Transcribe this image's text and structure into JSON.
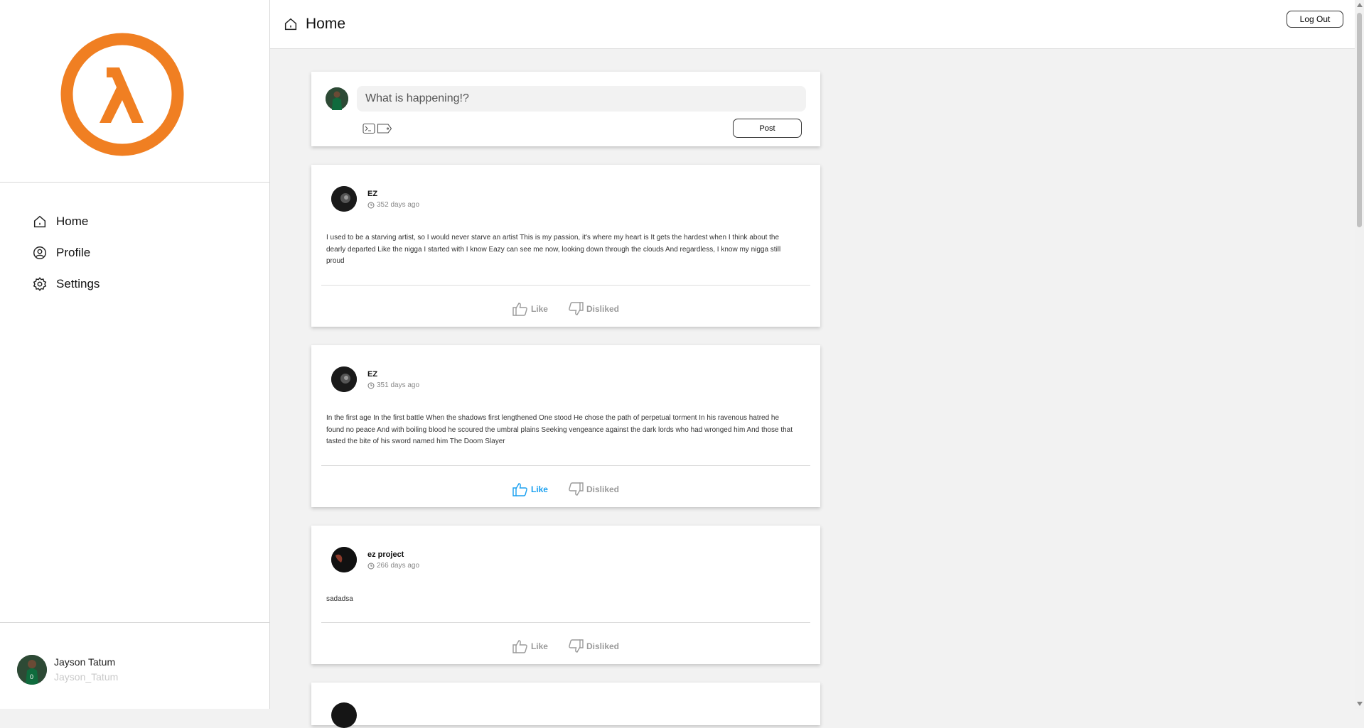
{
  "header": {
    "title": "Home",
    "logout_label": "Log Out"
  },
  "sidebar": {
    "logo": "half-life-lambda-logo",
    "nav": [
      {
        "label": "Home",
        "icon": "home-icon"
      },
      {
        "label": "Profile",
        "icon": "user-circle-icon"
      },
      {
        "label": "Settings",
        "icon": "gear-icon"
      }
    ],
    "user": {
      "name": "Jayson Tatum",
      "handle": "Jayson_Tatum"
    }
  },
  "composer": {
    "placeholder": "What is happening!?",
    "post_label": "Post"
  },
  "posts": [
    {
      "author": "EZ",
      "time": "352 days ago",
      "body": "I used to be a starving artist, so I would never starve an artist This is my passion, it's where my heart is It gets the hardest when I think about the dearly departed Like the nigga I started with I know Eazy can see me now, looking down through the clouds And regardless, I know my nigga still proud",
      "like_label": "Like",
      "dislike_label": "Disliked",
      "liked": false
    },
    {
      "author": "EZ",
      "time": "351 days ago",
      "body": "In the first age In the first battle When the shadows first lengthened One stood He chose the path of perpetual torment In his ravenous hatred he found no peace And with boiling blood he scoured the umbral plains Seeking vengeance against the dark lords who had wronged him And those that tasted the bite of his sword named him The Doom Slayer",
      "like_label": "Like",
      "dislike_label": "Disliked",
      "liked": true
    },
    {
      "author": "ez project",
      "time": "266 days ago",
      "body": "sadadsa",
      "like_label": "Like",
      "dislike_label": "Disliked",
      "liked": false
    }
  ],
  "colors": {
    "accent": "#f07f22",
    "like_active": "#1aa0f0"
  }
}
